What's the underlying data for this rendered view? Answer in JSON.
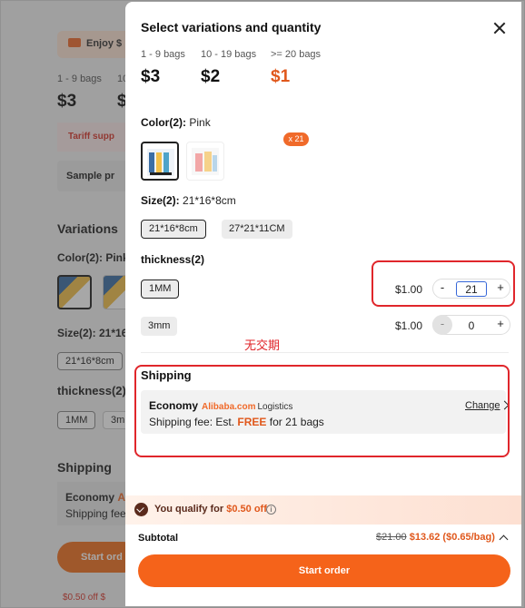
{
  "background": {
    "promo": "Enjoy $",
    "tiers": [
      {
        "label": "1 - 9 bags",
        "price": "$3"
      },
      {
        "label": "10",
        "price": "$"
      }
    ],
    "tariff": "Tariff supp",
    "sample": "Sample pr",
    "variations_heading": "Variations",
    "color_label": "Color(2): Pink",
    "size_label": "Size(2): 21*16*",
    "size_chip": "21*16*8cm",
    "thickness_label": "thickness(2)",
    "thickness_chip_1": "1MM",
    "thickness_chip_2": "3mn",
    "shipping_heading": "Shipping",
    "ship_line1": "Economy",
    "ship_brand": "A",
    "ship_line2": "Shipping fee",
    "start_btn": "Start ord",
    "off": "$0.50 off $"
  },
  "modal": {
    "title": "Select variations and quantity",
    "tiers": [
      {
        "label": "1 - 9 bags",
        "price": "$3"
      },
      {
        "label": "10 - 19 bags",
        "price": "$2"
      },
      {
        "label": ">= 20 bags",
        "price": "$1"
      }
    ],
    "color": {
      "label": "Color(2):",
      "value": "Pink",
      "badge": "x 21"
    },
    "size": {
      "label": "Size(2):",
      "value": "21*16*8cm",
      "options": [
        "21*16*8cm",
        "27*21*11CM"
      ]
    },
    "thickness": {
      "label": "thickness(2)",
      "rows": [
        {
          "option": "1MM",
          "price": "$1.00",
          "qty": "21",
          "minus": "-",
          "plus": "+"
        },
        {
          "option": "3mm",
          "price": "$1.00",
          "qty": "0",
          "minus": "-",
          "plus": "+"
        }
      ]
    },
    "annotation": "无交期",
    "shipping": {
      "title": "Shipping",
      "method": "Economy",
      "brand": "Alibaba.com",
      "logistics": "Logistics",
      "fee_prefix": "Shipping fee: Est.",
      "fee_value": "FREE",
      "fee_suffix": "for 21 bags",
      "change": "Change"
    },
    "qualify": {
      "prefix": "You qualify for",
      "amount": "$0.50 off",
      "info": "i"
    },
    "subtotal": {
      "label": "Subtotal",
      "old": "$21.00",
      "new": "$13.62 ($0.65/bag)"
    },
    "start_order": "Start order",
    "colors": {
      "accent": "#f5631a",
      "annotation": "#e0262b",
      "price_accent": "#e0581c"
    }
  }
}
